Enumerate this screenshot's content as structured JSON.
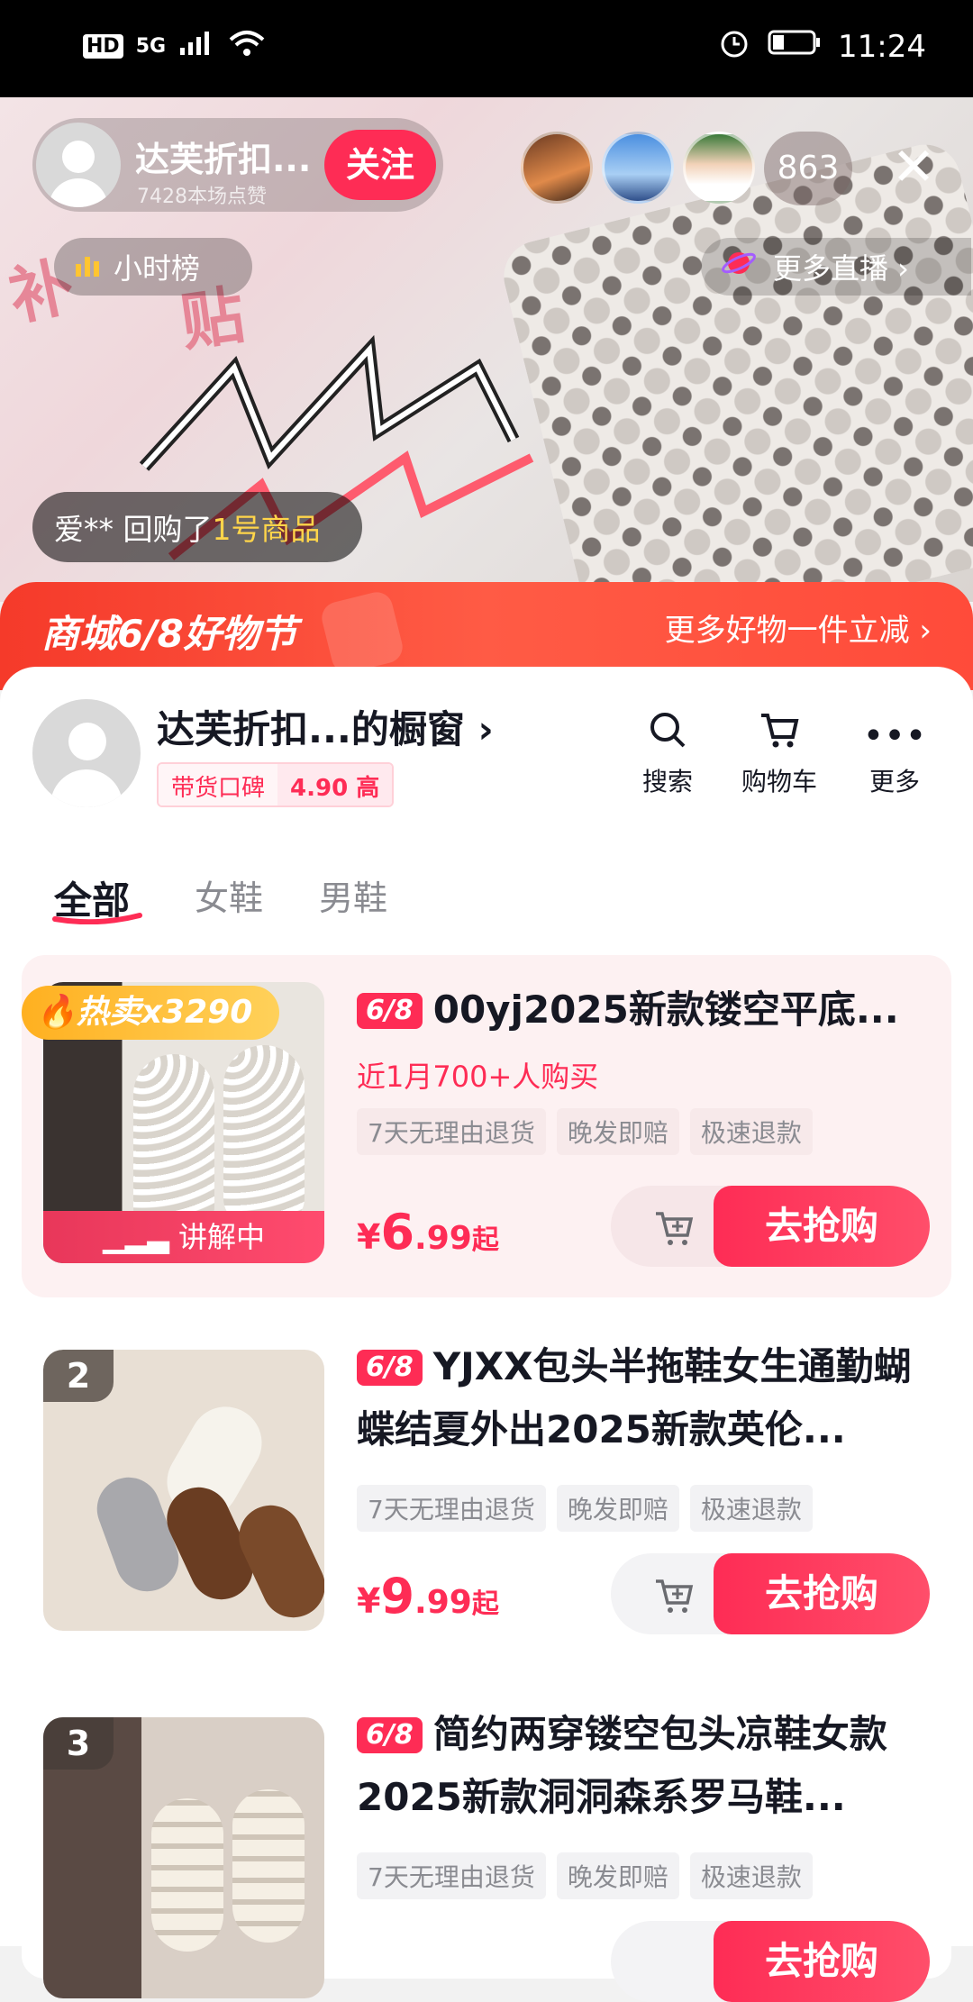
{
  "status_bar": {
    "network_hd": "HD",
    "network_5g": "5G",
    "time": "11:24"
  },
  "live": {
    "host_name": "达芙折扣...",
    "host_likes": "7428本场点赞",
    "follow_label": "关注",
    "viewer_count": "863",
    "rank_label": "小时榜",
    "more_live_label": "更多直播 ›",
    "toast": {
      "user": "爱**",
      "action": "回购了",
      "item": "1号商品"
    },
    "close_icon": "close-icon"
  },
  "promo": {
    "left": "商城6/8好物节",
    "right": "更多好物一件立减 ›"
  },
  "shop": {
    "title": "达芙折扣...的橱窗 ›",
    "rep_label": "带货口碑",
    "rep_value": "4.90 高",
    "tools": [
      {
        "label": "搜索",
        "icon": "search-icon"
      },
      {
        "label": "购物车",
        "icon": "cart-icon"
      },
      {
        "label": "更多",
        "icon": "more-icon"
      }
    ]
  },
  "tabs": [
    {
      "label": "全部",
      "active": true
    },
    {
      "label": "女鞋",
      "active": false
    },
    {
      "label": "男鞋",
      "active": false
    }
  ],
  "products": [
    {
      "hot": "热卖x3290",
      "explain": "讲解中",
      "tag": "6/8",
      "title": "00yj2025新款镂空平底...",
      "sub": "近1月700+人购买",
      "chips": [
        "7天无理由退货",
        "晚发即赔",
        "极速退款"
      ],
      "price_int": "6",
      "price_dec": ".99",
      "price_suffix": "起",
      "buy_label": "去抢购"
    },
    {
      "rank": "2",
      "tag": "6/8",
      "title": "YJXX包头半拖鞋女生通勤蝴蝶结夏外出2025新款英伦...",
      "chips": [
        "7天无理由退货",
        "晚发即赔",
        "极速退款"
      ],
      "price_int": "9",
      "price_dec": ".99",
      "price_suffix": "起",
      "buy_label": "去抢购"
    },
    {
      "rank": "3",
      "tag": "6/8",
      "title": "简约两穿镂空包头凉鞋女款2025新款洞洞森系罗马鞋...",
      "chips": [
        "7天无理由退货",
        "晚发即赔",
        "极速退款"
      ],
      "buy_label": "去抢购"
    }
  ],
  "currency": "¥"
}
